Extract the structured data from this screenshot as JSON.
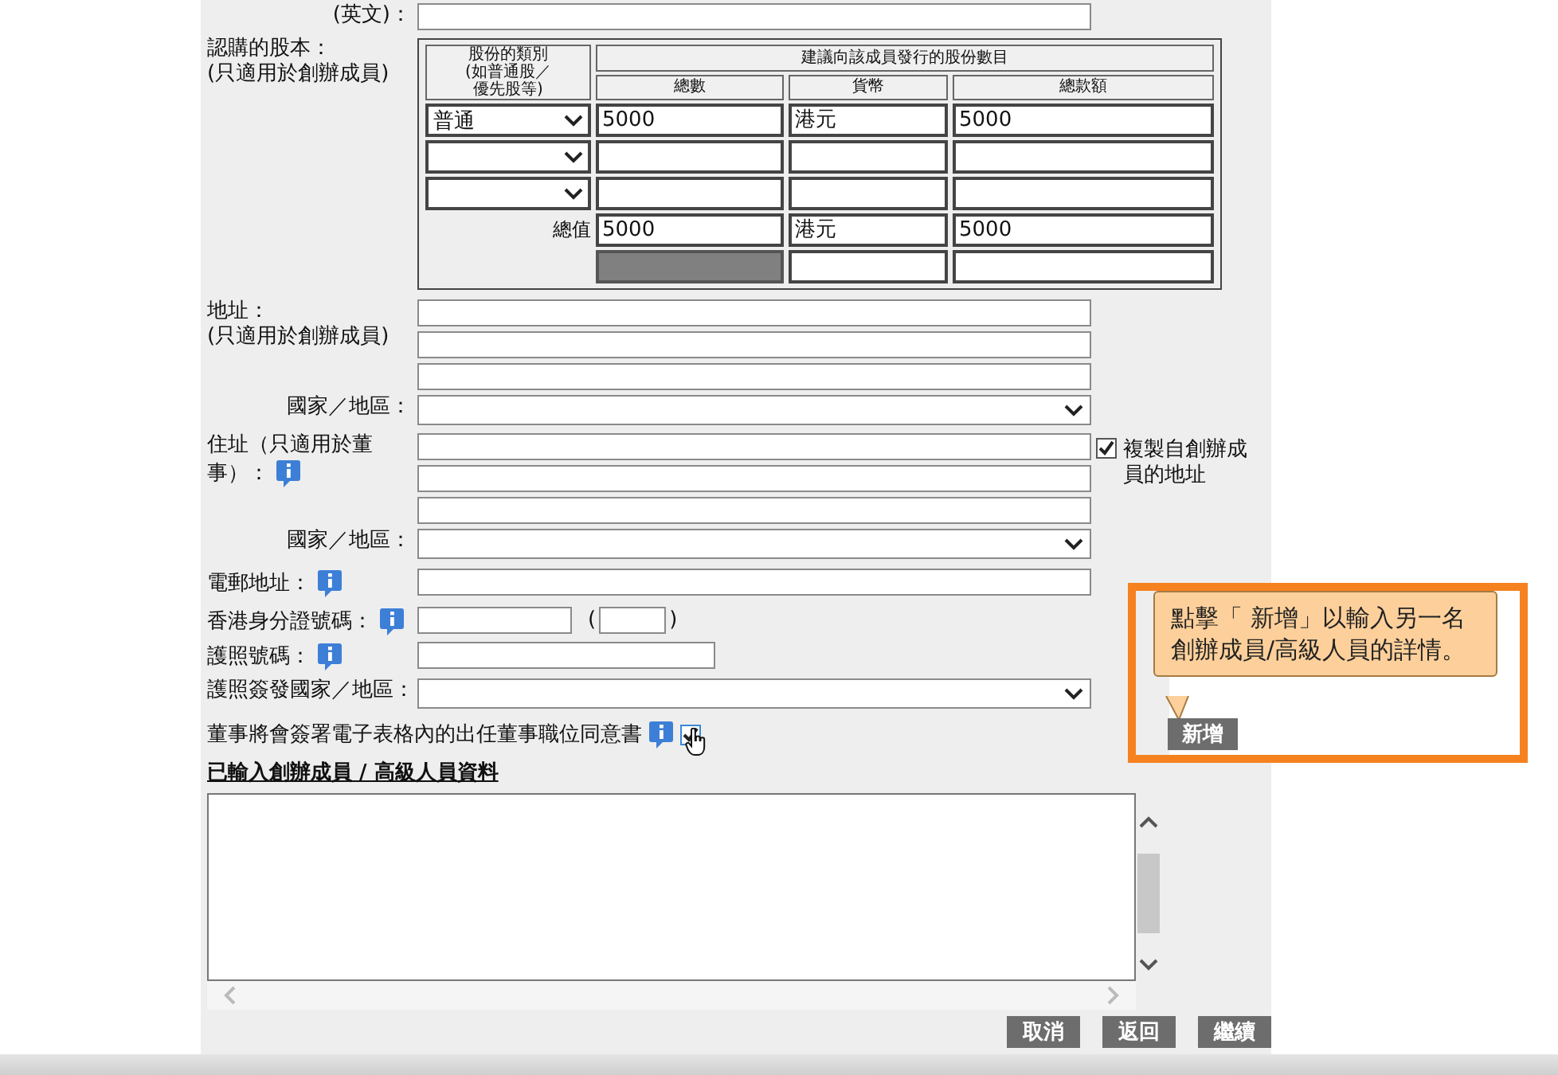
{
  "name_english": {
    "label": "(英文)："
  },
  "share_capital": {
    "label": "認購的股本：",
    "note": "(只適用於創辦成員)",
    "class_header": [
      "股份的類別",
      "(如普通股／",
      "優先股等)"
    ],
    "group_header": "建議向該成員發行的股份數目",
    "columns": [
      "總數",
      "貨幣",
      "總款額"
    ],
    "rows": [
      {
        "share_class": "普通",
        "count": "5000",
        "currency": "港元",
        "amount": "5000"
      },
      {},
      {}
    ],
    "totals": {
      "label": "總值",
      "count": "5000",
      "currency": "港元",
      "amount": "5000"
    }
  },
  "address": {
    "label": "地址：",
    "note": "(只適用於創辦成員)",
    "country_label": "國家／地區："
  },
  "residential": {
    "label_lines": [
      "住址（只適用於董",
      "事）："
    ],
    "country_label": "國家／地區：",
    "copy": {
      "label": "複製自創辦成員的地址",
      "checked": true
    }
  },
  "email": {
    "label": "電郵地址："
  },
  "hkid": {
    "label": "香港身分證號碼：",
    "open": "(",
    "close": ")"
  },
  "passport": {
    "label": "護照號碼："
  },
  "passport_country": {
    "label": "護照簽發國家／地區："
  },
  "consent": {
    "label": "董事將會簽署電子表格內的出任董事職位同意書",
    "checked": true
  },
  "entered_heading": "已輸入創辦成員 / 高級人員資料",
  "buttons": [
    "取消",
    "返回",
    "繼續"
  ],
  "callout": {
    "text": "點擊「 新增」以輸入另一名創辦成員/高級人員的詳情。",
    "button": "新增"
  }
}
